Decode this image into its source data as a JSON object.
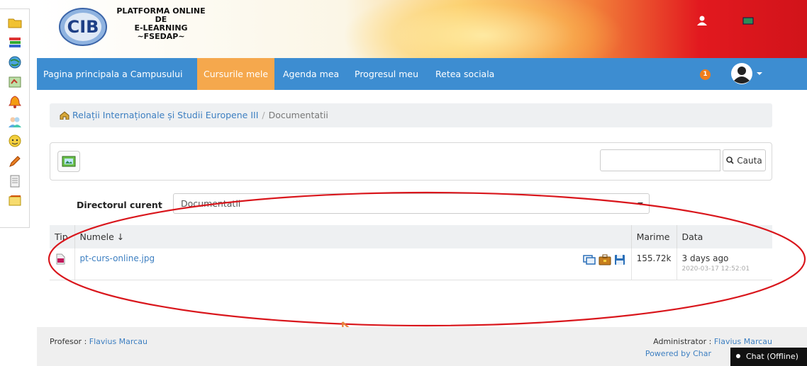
{
  "brand": {
    "logo_letters": "CIB",
    "line1": "PLATFORMA ONLINE DE",
    "line2": "E-LEARNING",
    "line3": "~FSEDAP~"
  },
  "nav": {
    "items": [
      {
        "label": "Pagina principala a Campusului"
      },
      {
        "label": "Cursurile mele"
      },
      {
        "label": "Agenda mea"
      },
      {
        "label": "Progresul meu"
      },
      {
        "label": "Retea sociala"
      }
    ],
    "active_index": 1,
    "notifications": "1"
  },
  "breadcrumb": {
    "course": "Relații Internaționale și Studii Europene III",
    "separator": "/",
    "current": "Documentatii"
  },
  "search": {
    "value": "",
    "button_label": "Cauta"
  },
  "directory": {
    "label": "Directorul curent",
    "selected": "Documentatii"
  },
  "table": {
    "headers": {
      "type": "Tip",
      "name": "Numele ↓",
      "size": "Marime",
      "date": "Data"
    },
    "rows": [
      {
        "name": "pt-curs-online.jpg",
        "size": "155.72k",
        "date_relative": "3 days ago",
        "date_full": "2020-03-17 12:52:01"
      }
    ]
  },
  "footer": {
    "professor_label": "Profesor :",
    "professor_name": "Flavius Marcau",
    "admin_label": "Administrator :",
    "admin_name": "Flavius Marcau",
    "powered_by": "Powered by Char"
  },
  "chat": {
    "label": "Chat (Offline)"
  },
  "colors": {
    "navbar": "#3d8dd1",
    "active_tab": "#f5a84d",
    "link": "#3d7fc1",
    "annotation": "#d9161c",
    "arrow": "#e8823c"
  }
}
